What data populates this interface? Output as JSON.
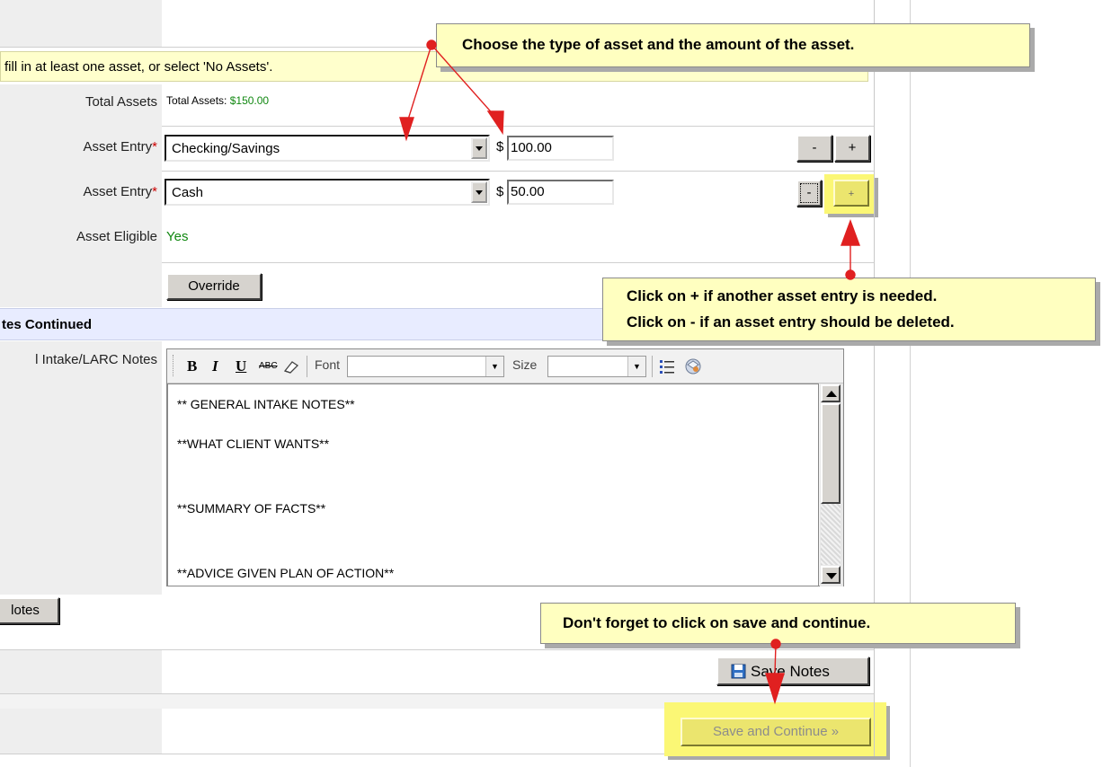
{
  "notice": "fill in at least one asset, or select 'No Assets'.",
  "totals": {
    "label": "Total Assets",
    "prefix": "Total Assets:",
    "value": "$150.00"
  },
  "asset_rows": [
    {
      "label": "Asset Entry",
      "required_mark": "*",
      "type": "Checking/Savings",
      "currency": "$",
      "amount": "100.00",
      "minus": "-",
      "plus": "+"
    },
    {
      "label": "Asset Entry",
      "required_mark": "*",
      "type": "Cash",
      "currency": "$",
      "amount": "50.00",
      "minus": "-",
      "plus": "+"
    }
  ],
  "eligible": {
    "label": "Asset Eligible",
    "value": "Yes"
  },
  "override_button": "Override",
  "section_heading": "tes Continued",
  "notes_label": "l Intake/LARC Notes",
  "editor": {
    "bold": "B",
    "italic": "I",
    "underline": "U",
    "spell": "ABC",
    "font_label": "Font",
    "font_value": "",
    "size_label": "Size",
    "size_value": "",
    "lines": [
      "** GENERAL INTAKE NOTES**",
      "**WHAT CLIENT WANTS**",
      "**SUMMARY OF FACTS**",
      "**ADVICE GIVEN PLAN OF ACTION**"
    ]
  },
  "notes_button": "lotes",
  "save_notes_button": "Save Notes",
  "save_continue_button": "Save and Continue »",
  "callouts": {
    "top": "Choose the type of asset and the amount of the asset.",
    "plus_minus_1": "Click on + if another asset entry is needed.",
    "plus_minus_2": "Click on - if an asset entry should be deleted.",
    "save": "Don't forget to click on save and continue."
  },
  "colors": {
    "green": "#118811",
    "required": "#cc0000",
    "callout_bg": "#ffffc0",
    "highlight": "#fbf775",
    "arrow": "#e02020",
    "section_bg": "#e8ecff"
  }
}
